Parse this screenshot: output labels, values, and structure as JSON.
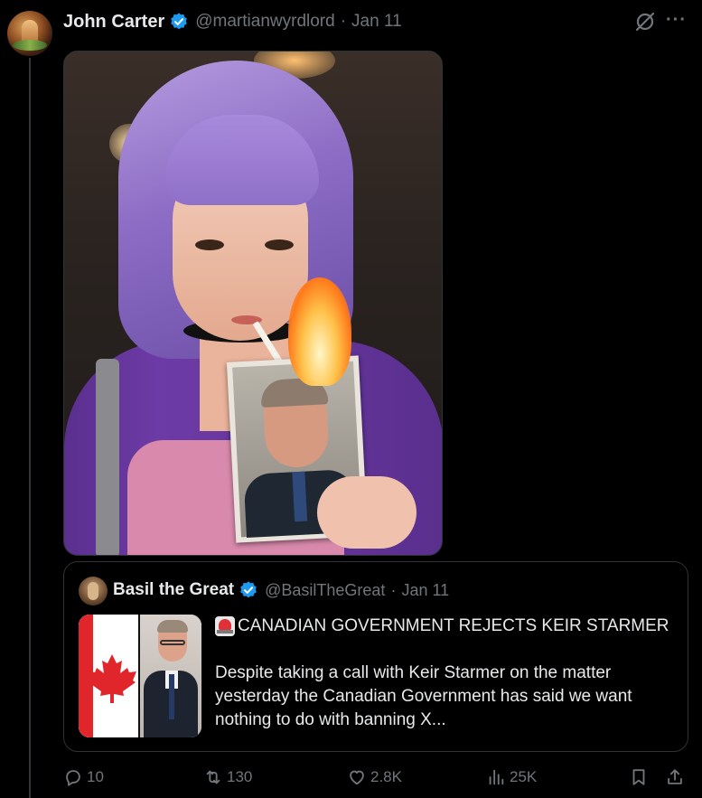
{
  "post": {
    "author": {
      "name": "John Carter",
      "handle": "@martianwyrdlord",
      "separator": "·",
      "date": "Jan 11",
      "verified": true,
      "avatar_icon": "avatar"
    },
    "header_icons": [
      "grok-icon",
      "more-icon"
    ],
    "more_label": "···",
    "media_icon": "photo"
  },
  "quote": {
    "author": {
      "name": "Basil the Great",
      "handle": "@BasilTheGreat",
      "separator": "·",
      "date": "Jan 11",
      "verified": true
    },
    "title": "CANADIAN GOVERNMENT REJECTS KEIR STARMER",
    "title_emoji": "siren-icon",
    "body": "Despite taking a call with Keir Starmer on the matter yesterday the Canadian Government has said we want nothing to do with banning X..."
  },
  "actions": {
    "replies": "10",
    "reposts": "130",
    "likes": "2.8K",
    "views": "25K"
  },
  "colors": {
    "background": "#000000",
    "text": "#e7e9ea",
    "muted": "#71767b",
    "border": "#2f3336",
    "verified": "#1d9bf0"
  }
}
